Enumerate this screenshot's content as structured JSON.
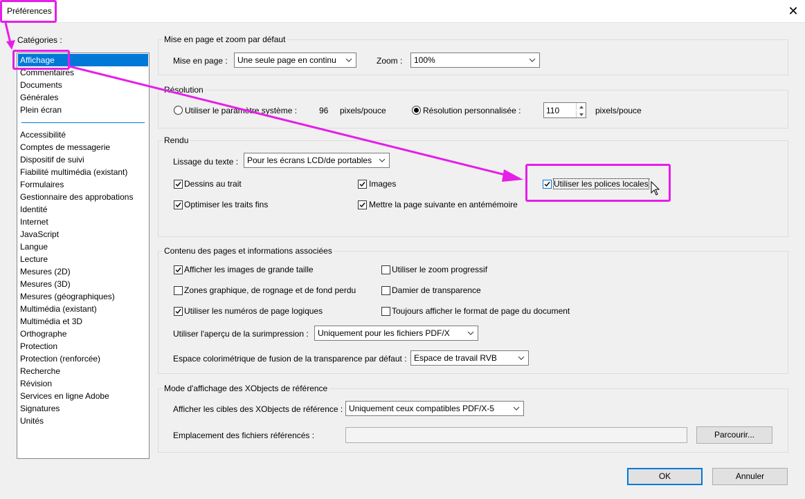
{
  "window": {
    "title": "Préférences",
    "close_icon": "close-icon"
  },
  "categories": {
    "label": "Catégories :",
    "top_items": [
      "Affichage",
      "Commentaires",
      "Documents",
      "Générales",
      "Plein écran"
    ],
    "selected": "Affichage",
    "items": [
      "Accessibilité",
      "Comptes de messagerie",
      "Dispositif de suivi",
      "Fiabilité multimédia (existant)",
      "Formulaires",
      "Gestionnaire des approbations",
      "Identité",
      "Internet",
      "JavaScript",
      "Langue",
      "Lecture",
      "Mesures (2D)",
      "Mesures (3D)",
      "Mesures (géographiques)",
      "Multimédia (existant)",
      "Multimédia et 3D",
      "Orthographe",
      "Protection",
      "Protection (renforcée)",
      "Recherche",
      "Révision",
      "Services en ligne Adobe",
      "Signatures",
      "Unités"
    ]
  },
  "layout_zoom": {
    "title": "Mise en page et zoom par défaut",
    "page_layout_label": "Mise en page :",
    "page_layout_value": "Une seule page en continu",
    "zoom_label": "Zoom :",
    "zoom_value": "100%"
  },
  "resolution": {
    "title": "Résolution",
    "system_label": "Utiliser le paramètre système :",
    "system_value": "96",
    "system_unit": "pixels/pouce",
    "system_selected": false,
    "custom_label": "Résolution personnalisée :",
    "custom_value": "110",
    "custom_unit": "pixels/pouce",
    "custom_selected": true
  },
  "rendering": {
    "title": "Rendu",
    "smoothing_label": "Lissage du texte :",
    "smoothing_value": "Pour les écrans LCD/de portables",
    "line_art": {
      "label": "Dessins au trait",
      "checked": true
    },
    "images": {
      "label": "Images",
      "checked": true
    },
    "local_fonts": {
      "label": "Utiliser les polices locales",
      "checked": true
    },
    "thin_lines": {
      "label": "Optimiser les traits fins",
      "checked": true
    },
    "cache_next_page": {
      "label": "Mettre la page suivante en antémémoire",
      "checked": true
    }
  },
  "page_content": {
    "title": "Contenu des pages et informations associées",
    "large_images": {
      "label": "Afficher les images de grande taille",
      "checked": true
    },
    "smooth_zoom": {
      "label": "Utiliser le zoom progressif",
      "checked": false
    },
    "boxes": {
      "label": "Zones graphique, de rognage et de fond perdu",
      "checked": false
    },
    "transparency_grid": {
      "label": "Damier de transparence",
      "checked": false
    },
    "logical_page_numbers": {
      "label": "Utiliser les numéros de page logiques",
      "checked": true
    },
    "always_show_page_size": {
      "label": "Toujours afficher le format de page du document",
      "checked": false
    },
    "overprint_label": "Utiliser l'aperçu de la surimpression :",
    "overprint_value": "Uniquement pour les fichiers PDF/X",
    "blend_space_label": "Espace colorimétrique de fusion de la transparence par défaut :",
    "blend_space_value": "Espace de travail RVB"
  },
  "xobjects": {
    "title": "Mode d'affichage des XObjects de référence",
    "targets_label": "Afficher les cibles des XObjects de référence :",
    "targets_value": "Uniquement ceux compatibles PDF/X-5",
    "location_label": "Emplacement des fichiers référencés :",
    "location_value": "",
    "browse_label": "Parcourir..."
  },
  "buttons": {
    "ok": "OK",
    "cancel": "Annuler"
  },
  "annotation_color": "#e51ee8",
  "accent_color": "#0078d7"
}
